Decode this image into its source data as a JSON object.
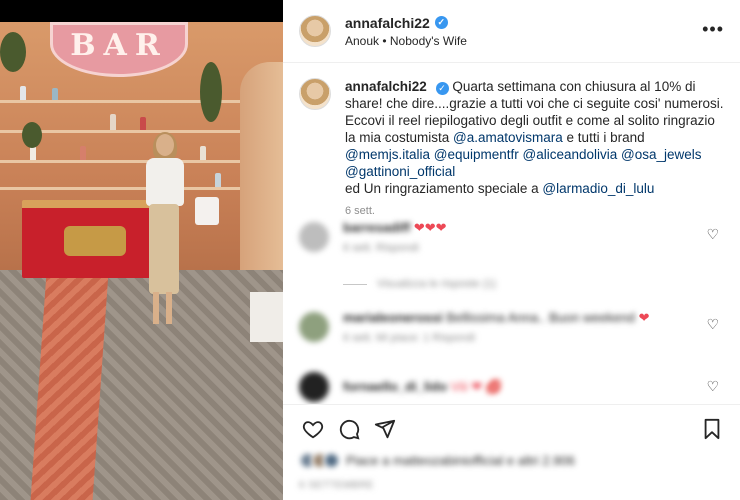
{
  "video": {
    "sign_text": "BAR"
  },
  "post": {
    "username": "annafalchi22",
    "audio": "Anouk • Nobody's Wife",
    "more_icon": "more-horizontal-icon"
  },
  "caption": {
    "username": "annafalchi22",
    "text_1": "Quarta settimana con chiusura al 10% di share! che dire....grazie a tutti voi che ci seguite cosi' numerosi. Eccovi il reel riepilogativo degli outfit e come al solito ringrazio la mia costumista ",
    "mention_1": "@a.amatovismara",
    "text_2": " e tutti i brand ",
    "mention_2": "@memjs.italia",
    "mention_3": "@equipmentfr",
    "mention_4": "@aliceandolivia",
    "mention_5": "@osa_jewels",
    "mention_6": "@gattinoni_official",
    "text_3": "ed Un ringraziamento speciale a ",
    "mention_7": "@larmadio_di_lulu",
    "time": "6 sett."
  },
  "comments": [
    {
      "user": "barresadiff",
      "text": "❤❤❤",
      "meta": "6 sett.   Rispondi",
      "replies": "Visualizza le risposte (1)"
    },
    {
      "user": "marialeonerossi",
      "text": "Bellissima Anna.. Buon weekend",
      "meta": "6 sett.   Mi piace: 1   Rispondi"
    },
    {
      "user": "fornaello_di_lido",
      "text": "Viii ❤ 💋",
      "meta": ""
    }
  ],
  "likes": {
    "text": "Piace a matteozabiniofficial e altri 2.906"
  },
  "date": "6 SETTEMBRE",
  "colors": {
    "link": "#00376b",
    "verified": "#3897f0",
    "heart_red": "#ed4956",
    "secondary_text": "#8e8e8e"
  }
}
